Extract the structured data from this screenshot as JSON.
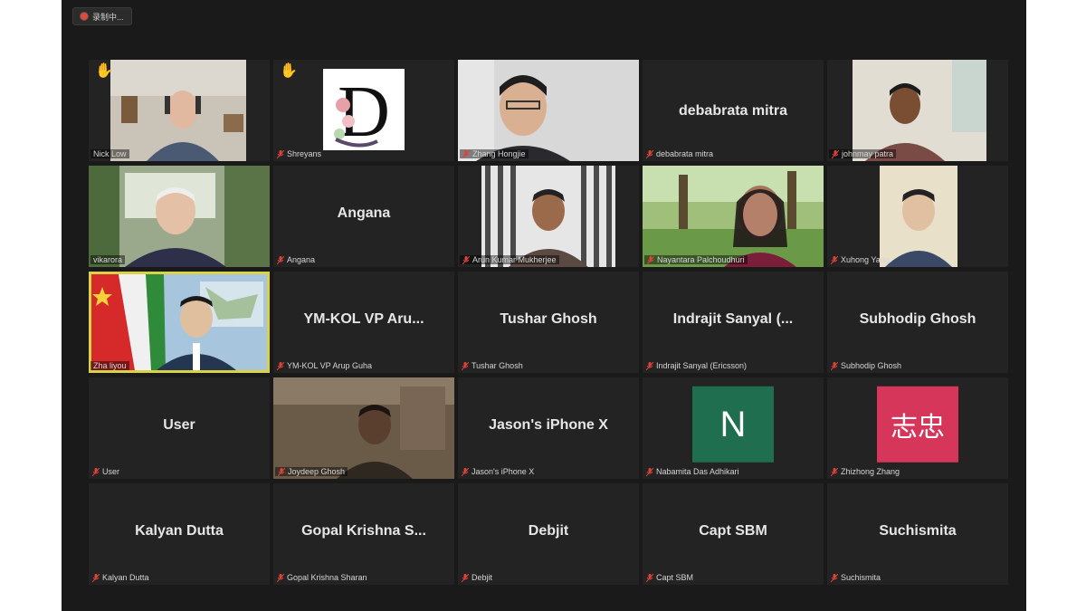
{
  "recording": {
    "label": "录制中..."
  },
  "participants": [
    {
      "caption": "Nick Low",
      "hand": true
    },
    {
      "caption": "Shreyans",
      "hand": true
    },
    {
      "caption": "Zhang Hongjie"
    },
    {
      "display": "debabrata mitra",
      "caption": "debabrata mitra"
    },
    {
      "caption": "johnmay patra"
    },
    {
      "caption": "vikarora"
    },
    {
      "display": "Angana",
      "caption": "Angana"
    },
    {
      "caption": "Arun Kumar Mukherjee"
    },
    {
      "caption": "Nayantara Palchoudhuri"
    },
    {
      "caption": "Xuhong Yang"
    },
    {
      "caption": "Zha liyou",
      "active": true
    },
    {
      "display": "YM-KOL VP Aru...",
      "caption": "YM-KOL VP Arup Guha"
    },
    {
      "display": "Tushar Ghosh",
      "caption": "Tushar Ghosh"
    },
    {
      "display": "Indrajit Sanyal (...",
      "caption": "Indrajit Sanyal (Ericsson)"
    },
    {
      "display": "Subhodip Ghosh",
      "caption": "Subhodip Ghosh"
    },
    {
      "display": "User",
      "caption": "User"
    },
    {
      "caption": "Joydeep Ghosh"
    },
    {
      "display": "Jason's iPhone X",
      "caption": "Jason's iPhone X"
    },
    {
      "avatar": "N",
      "caption": "Nabamita Das Adhikari"
    },
    {
      "avatar": "志忠",
      "caption": "Zhizhong Zhang"
    },
    {
      "display": "Kalyan Dutta",
      "caption": "Kalyan Dutta"
    },
    {
      "display": "Gopal Krishna S...",
      "caption": "Gopal Krishna Sharan"
    },
    {
      "display": "Debjit",
      "caption": "Debjit"
    },
    {
      "display": "Capt SBM",
      "caption": "Capt SBM"
    },
    {
      "display": "Suchismita",
      "caption": "Suchismita"
    }
  ],
  "colors": {
    "background": "#1a1a1a",
    "tile": "#232323",
    "active_speaker": "#d7d24a",
    "muted_mic": "#e0433a",
    "avatar_n": "#1f6e4f",
    "avatar_zhizhong": "#d6365a"
  },
  "icons": {
    "mic": "muted-mic-icon",
    "hand": "raised-hand-icon",
    "rec": "record-icon"
  }
}
